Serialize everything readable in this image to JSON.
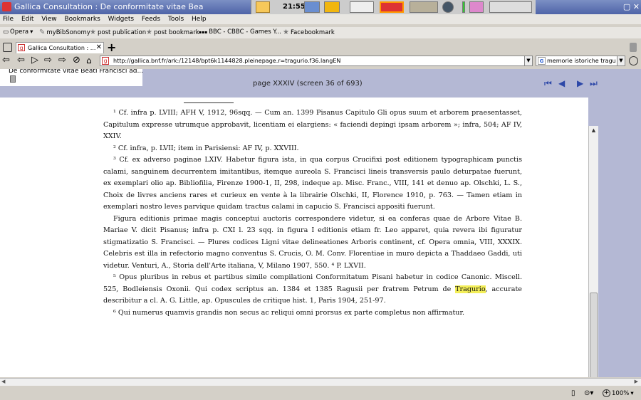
{
  "window": {
    "title": "Gallica Consultation : De conformitate vitae Bea",
    "clock": "21:55"
  },
  "menu": [
    "File",
    "Edit",
    "View",
    "Bookmarks",
    "Widgets",
    "Feeds",
    "Tools",
    "Help"
  ],
  "bookmarks": [
    "Opera",
    "myBibSonomy",
    "post publication",
    "post bookmark",
    "BBC - CBBC - Games Y...",
    "Facebookmark"
  ],
  "tab": {
    "label": "Gallica Consultation : ...",
    "close": "✕"
  },
  "address": {
    "url": "http://gallica.bnf.fr/ark:/12148/bpt6k1144828.pleinepage.r=tragurio.f36.langEN",
    "search": "memorie istoriche tragurio"
  },
  "viewer": {
    "doc_title": "De conformitate vitae Beati Francisci ad...",
    "page_indicator": "page XXXIV (screen 36 of 693)"
  },
  "scan": {
    "fn1a": "¹ Cf. infra p. LVIII; AFH V, 1912, 96sqq. — Cum an. 1399 Pisanus Capitulo Gli opus suum et arborem praesentasset, Capitulum expresse utrumque approbavit, licentiam ei elargiens: « faciendi depingi ipsam arborem »; infra, 504; AF IV, XXIV.",
    "fn2": "² Cf. infra, p. LVII; item in Parisiensi: AF IV, p. XXVIII.",
    "fn3": "³ Cf. ex adverso paginae LXIV. Habetur figura ista, in qua corpus Crucifixi post editionem typographicam punctis calami, sanguinem decurrentem imitantibus, itemque aureola S. Francisci lineis transversis paulo deturpatae fuerunt, ex exemplari olio ap. Bibliofilia, Firenze 1900-1, II, 298, indeque ap. Misc. Franc., VIII, 141 et denuo ap. Olschki, L. S., Choix de livres anciens rares et curieux en vente à la librairie Olschki, II, Florence 1910, p. 763. — Tamen etiam in exemplari nostro leves parvique quidam tractus calami in capucio S. Francisci appositi fuerunt.",
    "para": "Figura editionis primae magis conceptui auctoris correspondere videtur, si ea conferas quae de Arbore Vitae B. Mariae V. dicit Pisanus; infra p. CXI l. 23 sqq. in figura I editionis etiam fr. Leo apparet, quia revera ibi figuratur stigmatizatio S. Francisci. — Plures codices Ligni vitae delineationes Arboris continent, cf. Opera omnia, VIII, XXXIX. Celebris est illa in refectorio magno conventus S. Crucis, O. M. Conv. Florentiae in muro depicta a Thaddaeo Gaddi, uti videtur. Venturi, A., Storia dell'Arte italiana, V, Milano 1907, 550. ⁴ P. LXVII.",
    "fn5a": "⁵ Opus pluribus in rebus et partibus simile compilationi Conformitatum Pisani habetur in codice Canonic. Miscell. 525, Bodleiensis Oxonii. Qui codex scriptus an. 1384 et 1385 Ragusii per fratrem Petrum de ",
    "fn5hl": "Tragurio",
    "fn5b": ", accurate describitur a cl. A. G. Little, ap. Opuscules de critique hist. 1, Paris 1904, 251-97.",
    "fn6": "⁶ Qui numerus quamvis grandis non secus ac reliqui omni prorsus ex parte completus non affirmatur."
  },
  "status": {
    "zoom": "100%"
  }
}
